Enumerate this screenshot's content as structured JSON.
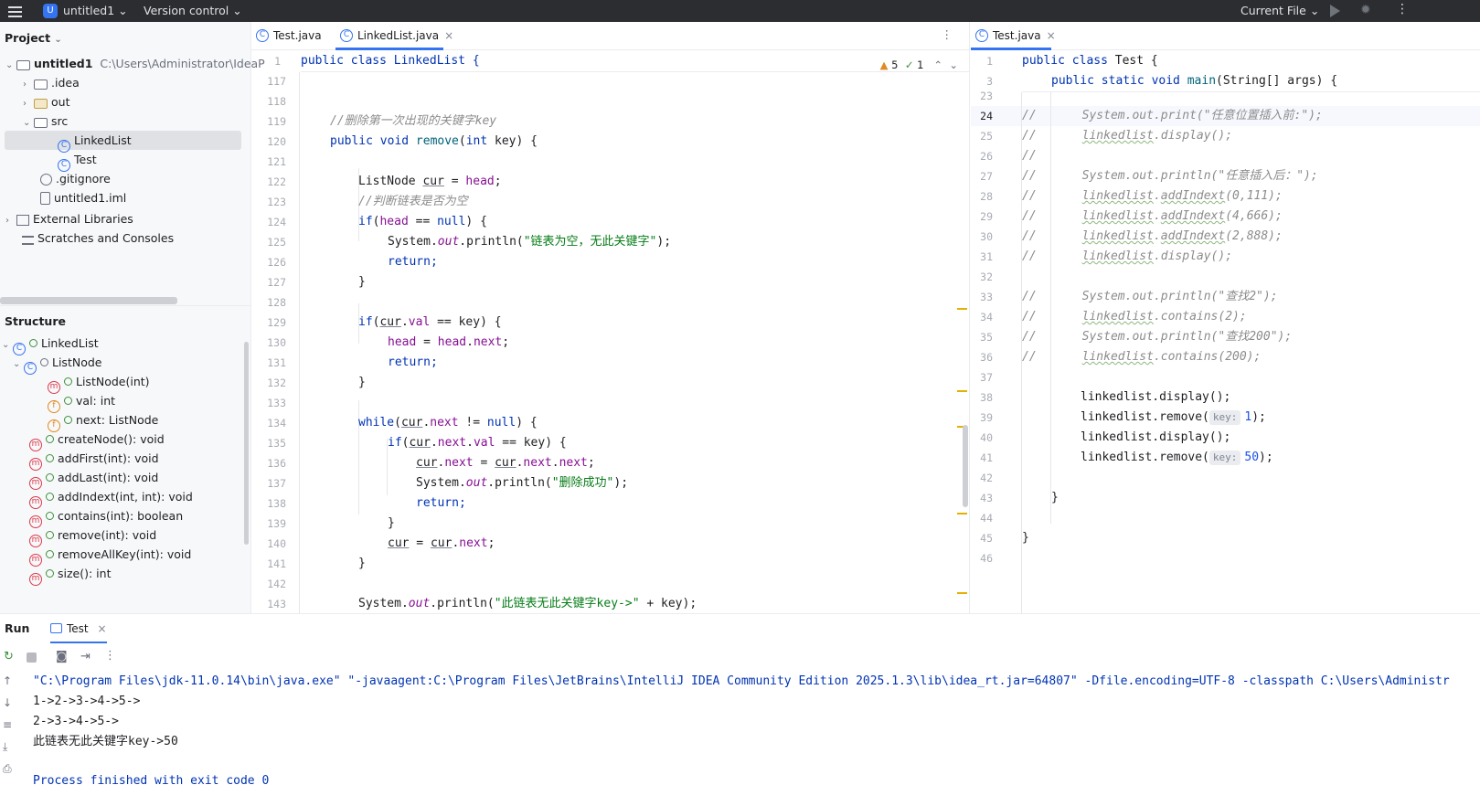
{
  "titlebar": {
    "project_badge": "U",
    "project_name": "untitled1",
    "version_control": "Version control",
    "run_config": "Current File"
  },
  "project_panel": {
    "title": "Project",
    "root": {
      "name": "untitled1",
      "path": "C:\\Users\\Administrator\\IdeaP"
    },
    "items": [
      {
        "label": ".idea"
      },
      {
        "label": "out"
      },
      {
        "label": "src"
      },
      {
        "label": "LinkedList"
      },
      {
        "label": "Test"
      },
      {
        "label": ".gitignore"
      },
      {
        "label": "untitled1.iml"
      },
      {
        "label": "External Libraries"
      },
      {
        "label": "Scratches and Consoles"
      }
    ]
  },
  "structure_panel": {
    "title": "Structure",
    "items": [
      {
        "label": "LinkedList",
        "icon": "C"
      },
      {
        "label": "ListNode",
        "icon": "C"
      },
      {
        "label": "ListNode(int)",
        "icon": "m"
      },
      {
        "label": "val: int",
        "icon": "f"
      },
      {
        "label": "next: ListNode",
        "icon": "f"
      },
      {
        "label": "createNode(): void",
        "icon": "m"
      },
      {
        "label": "addFirst(int): void",
        "icon": "m"
      },
      {
        "label": "addLast(int): void",
        "icon": "m"
      },
      {
        "label": "addIndext(int, int): void",
        "icon": "m"
      },
      {
        "label": "contains(int): boolean",
        "icon": "m"
      },
      {
        "label": "remove(int): void",
        "icon": "m"
      },
      {
        "label": "removeAllKey(int): void",
        "icon": "m"
      },
      {
        "label": "size(): int",
        "icon": "m"
      }
    ]
  },
  "editor_left": {
    "tabs": [
      {
        "label": "Test.java"
      },
      {
        "label": "LinkedList.java"
      }
    ],
    "inspection": {
      "warnings": "5",
      "ok": "1"
    },
    "sticky_line": {
      "num": "1",
      "text": "public class LinkedList {"
    },
    "line_numbers": [
      "117",
      "118",
      "119",
      "120",
      "121",
      "122",
      "123",
      "124",
      "125",
      "126",
      "127",
      "128",
      "129",
      "130",
      "131",
      "132",
      "133",
      "134",
      "135",
      "136",
      "137",
      "138",
      "139",
      "140",
      "141",
      "142",
      "143"
    ],
    "code": {
      "l118": "//删除第一次出现的关键字key",
      "l119_a": "public void ",
      "l119_b": "remove",
      "l119_c": "(",
      "l119_d": "int",
      "l119_e": " key) {",
      "l121_a": "ListNode ",
      "l121_b": "cur",
      "l121_c": " = ",
      "l121_d": "head",
      "l121_e": ";",
      "l122": "//判断链表是否为空",
      "l123_a": "if",
      "l123_b": "(",
      "l123_c": "head",
      "l123_d": " == ",
      "l123_e": "null",
      "l123_f": ") {",
      "l124_a": "System.",
      "l124_b": "out",
      "l124_c": ".println(",
      "l124_d": "\"链表为空，无此关键字\"",
      "l124_e": ");",
      "l125": "return;",
      "l126": "}",
      "l128_a": "if",
      "l128_b": "(",
      "l128_c": "cur",
      "l128_d": ".",
      "l128_e": "val",
      "l128_f": " == key) {",
      "l129_a": "head",
      "l129_b": " = ",
      "l129_c": "head",
      "l129_d": ".",
      "l129_e": "next",
      "l129_f": ";",
      "l130": "return;",
      "l131": "}",
      "l133_a": "while",
      "l133_b": "(",
      "l133_c": "cur",
      "l133_d": ".",
      "l133_e": "next",
      "l133_f": " != ",
      "l133_g": "null",
      "l133_h": ") {",
      "l134_a": "if",
      "l134_b": "(",
      "l134_c": "cur",
      "l134_d": ".",
      "l134_e": "next",
      "l134_f": ".",
      "l134_g": "val",
      "l134_h": " == key) {",
      "l135_a": "cur",
      "l135_b": ".",
      "l135_c": "next",
      "l135_d": " = ",
      "l135_e": "cur",
      "l135_f": ".",
      "l135_g": "next",
      "l135_h": ".",
      "l135_i": "next",
      "l135_j": ";",
      "l136_a": "System.",
      "l136_b": "out",
      "l136_c": ".println(",
      "l136_d": "\"删除成功\"",
      "l136_e": ");",
      "l137": "return;",
      "l138": "}",
      "l139_a": "cur",
      "l139_b": " = ",
      "l139_c": "cur",
      "l139_d": ".",
      "l139_e": "next",
      "l139_f": ";",
      "l140": "}",
      "l142_a": "System.",
      "l142_b": "out",
      "l142_c": ".println(",
      "l142_d": "\"此链表无此关键字key->\"",
      "l142_e": " + key);"
    }
  },
  "editor_right": {
    "tabs": [
      {
        "label": "Test.java"
      }
    ],
    "sticky": [
      {
        "num": "1",
        "a": "public class ",
        "b": "Test {"
      },
      {
        "num": "3",
        "a": "public static void ",
        "b": "main",
        "c": "(String[] args) {"
      }
    ],
    "line_numbers": [
      "23",
      "24",
      "25",
      "26",
      "27",
      "28",
      "29",
      "30",
      "31",
      "32",
      "33",
      "34",
      "35",
      "36",
      "37",
      "38",
      "39",
      "40",
      "41",
      "42",
      "43",
      "44",
      "45",
      "46"
    ],
    "code": {
      "c24_a": "//",
      "c24_b": "System.",
      "c24_c": "out",
      "c24_d": ".print(",
      "c24_e": "\"任意位置插入前:\"",
      "c24_f": ");",
      "c25_a": "//",
      "c25_b": "linkedlist",
      "c25_c": ".display();",
      "c26_a": "//",
      "c27_a": "//",
      "c27_b": "System.",
      "c27_c": "out",
      "c27_d": ".println(",
      "c27_e": "\"任意插入后：\"",
      "c27_f": ");",
      "c28_a": "//",
      "c28_b": "linkedlist",
      "c28_c": ".",
      "c28_d": "addIndext",
      "c28_e": "(0,111);",
      "c29_a": "//",
      "c29_b": "linkedlist",
      "c29_c": ".",
      "c29_d": "addIndext",
      "c29_e": "(4,666);",
      "c30_a": "//",
      "c30_b": "linkedlist",
      "c30_c": ".",
      "c30_d": "addIndext",
      "c30_e": "(2,888);",
      "c31_a": "//",
      "c31_b": "linkedlist",
      "c31_c": ".display();",
      "c33_a": "//",
      "c33_b": "System.",
      "c33_c": "out",
      "c33_d": ".println(",
      "c33_e": "\"查找2\"",
      "c33_f": ");",
      "c34_a": "//",
      "c34_b": "linkedlist",
      "c34_c": ".contains(2);",
      "c35_a": "//",
      "c35_b": "System.",
      "c35_c": "out",
      "c35_d": ".println(",
      "c35_e": "\"查找200\"",
      "c35_f": ");",
      "c36_a": "//",
      "c36_b": "linkedlist",
      "c36_c": ".contains(200);",
      "c38": "linkedlist.display();",
      "c39_a": "linkedlist.remove(",
      "c39_hint": "key:",
      "c39_b": "1",
      "c39_c": ");",
      "c40": "linkedlist.display();",
      "c41_a": "linkedlist.remove(",
      "c41_hint": "key:",
      "c41_b": "50",
      "c41_c": ");",
      "c43": "}",
      "c45": "}"
    }
  },
  "run_panel": {
    "title": "Run",
    "tab": "Test",
    "output": [
      "\"C:\\Program Files\\jdk-11.0.14\\bin\\java.exe\" \"-javaagent:C:\\Program Files\\JetBrains\\IntelliJ IDEA Community Edition 2025.1.3\\lib\\idea_rt.jar=64807\" -Dfile.encoding=UTF-8 -classpath C:\\Users\\Administr",
      "1->2->3->4->5->",
      "2->3->4->5->",
      "此链表无此关键字key->50",
      "",
      "Process finished with exit code 0"
    ]
  }
}
